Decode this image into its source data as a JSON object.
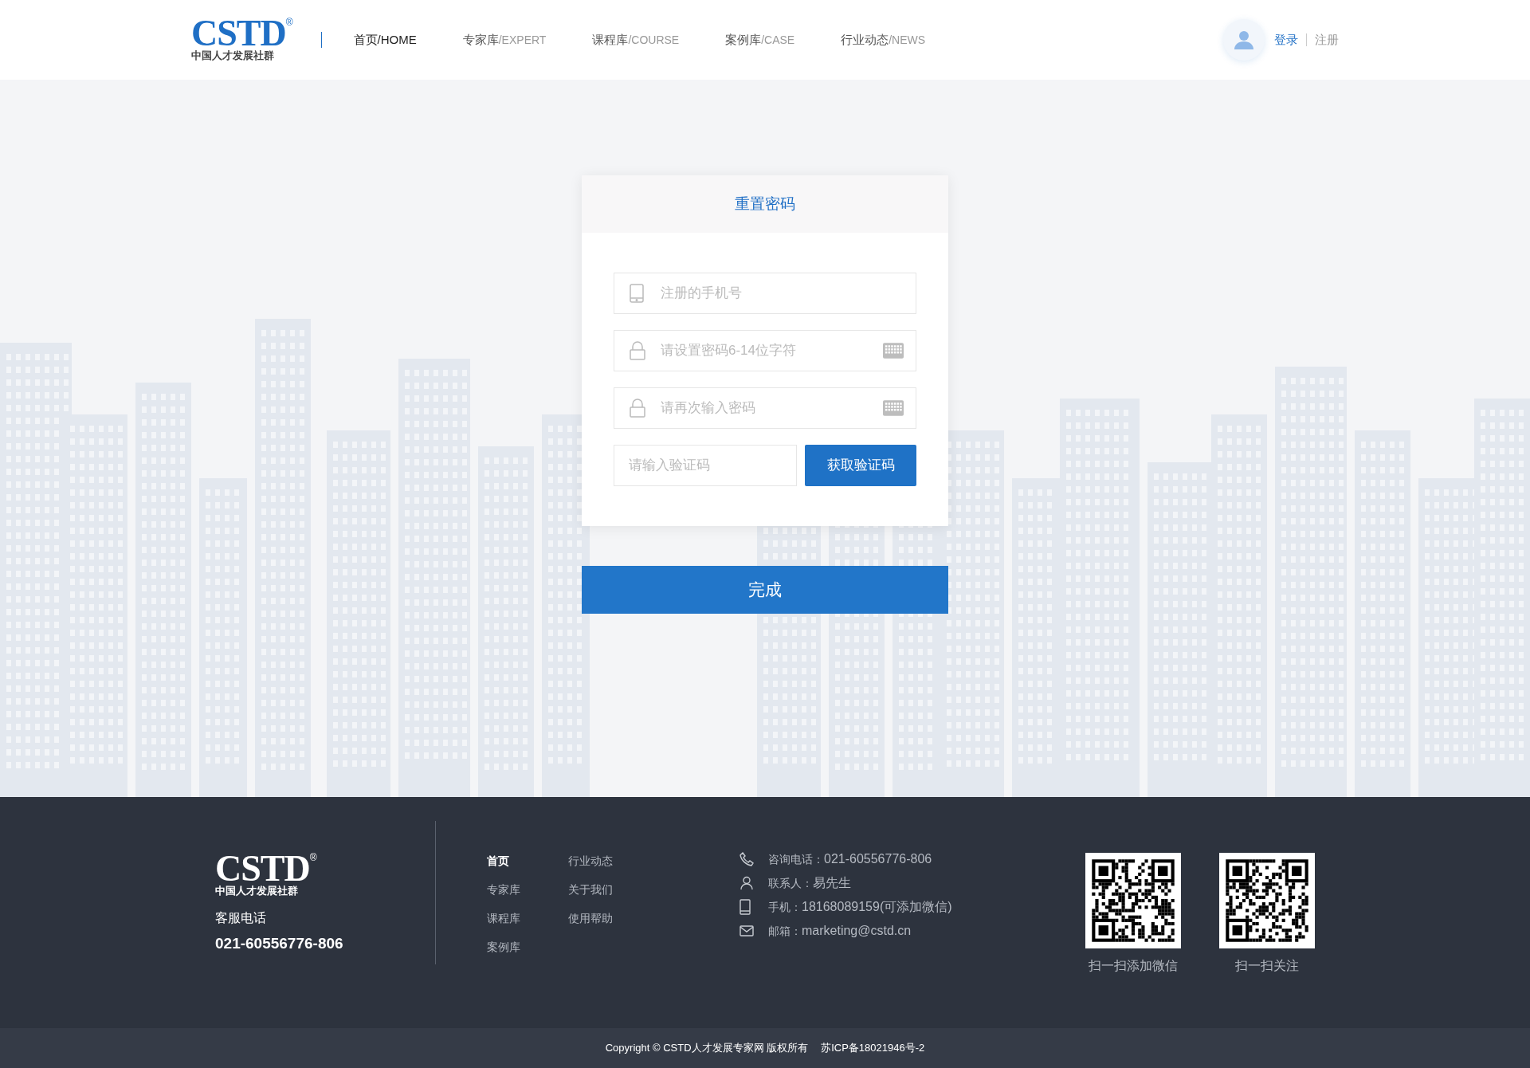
{
  "header": {
    "logo": {
      "mark": "CSTD",
      "registered": "®",
      "tagline": "中国人才发展社群"
    },
    "nav": [
      {
        "label": "首页",
        "suffix": "/HOME",
        "selected": true
      },
      {
        "label": "专家库",
        "suffix": "/EXPERT",
        "selected": false
      },
      {
        "label": "课程库",
        "suffix": "/COURSE",
        "selected": false
      },
      {
        "label": "案例库",
        "suffix": "/CASE",
        "selected": false
      },
      {
        "label": "行业动态",
        "suffix": "/NEWS",
        "selected": false
      }
    ],
    "login": "登录",
    "register": "注册"
  },
  "form": {
    "title": "重置密码",
    "fields": [
      {
        "kind": "phone",
        "placeholder": "注册的手机号",
        "keyboard": false
      },
      {
        "kind": "password",
        "placeholder": "请设置密码6-14位字符",
        "keyboard": true
      },
      {
        "kind": "password",
        "placeholder": "请再次输入密码",
        "keyboard": true
      }
    ],
    "code": {
      "placeholder": "请输入验证码",
      "button": "获取验证码"
    },
    "submit": "完成"
  },
  "footer": {
    "logo": {
      "mark": "CSTD",
      "registered": "®",
      "tagline": "中国人才发展社群"
    },
    "service_label": "客服电话",
    "service_phone": "021-60556776-806",
    "links": [
      {
        "label": "首页",
        "selected": true
      },
      {
        "label": "行业动态",
        "selected": false
      },
      {
        "label": "专家库",
        "selected": false
      },
      {
        "label": "关于我们",
        "selected": false
      },
      {
        "label": "课程库",
        "selected": false
      },
      {
        "label": "使用帮助",
        "selected": false
      },
      {
        "label": "案例库",
        "selected": false
      }
    ],
    "contacts": [
      {
        "kind": "phone",
        "label": "咨询电话：",
        "value": "021-60556776-806"
      },
      {
        "kind": "person",
        "label": "联系人：",
        "value": "易先生"
      },
      {
        "kind": "mobile",
        "label": "手机：",
        "value": "18168089159(可添加微信)"
      },
      {
        "kind": "mail",
        "label": "邮箱：",
        "value": "marketing@cstd.cn"
      }
    ],
    "qr_codes": [
      {
        "caption": "扫一扫添加微信"
      },
      {
        "caption": "扫一扫关注"
      }
    ],
    "copyright": "Copyright © CSTD人才发展专家网 版权所有",
    "icp": "苏ICP备18021946号-2"
  }
}
